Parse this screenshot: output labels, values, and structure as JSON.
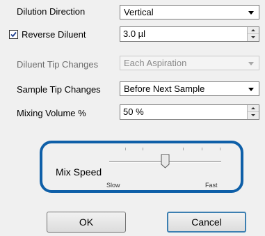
{
  "dilution_direction": {
    "label": "Dilution Direction",
    "value": "Vertical"
  },
  "reverse_diluent": {
    "label": "Reverse Diluent",
    "checked": true,
    "value": "3.0 µl"
  },
  "diluent_tip_changes": {
    "label": "Diluent Tip Changes",
    "value": "Each Aspiration",
    "disabled": true
  },
  "sample_tip_changes": {
    "label": "Sample Tip Changes",
    "value": "Before Next Sample"
  },
  "mixing_volume": {
    "label": "Mixing Volume %",
    "value": "50 %"
  },
  "mix_speed": {
    "label": "Mix Speed",
    "min_label": "Slow",
    "max_label": "Fast",
    "level": 0.5
  },
  "buttons": {
    "ok": "OK",
    "cancel": "Cancel"
  },
  "colors": {
    "highlight": "#0e5fa8",
    "default_button_border": "#3c7fb1"
  }
}
